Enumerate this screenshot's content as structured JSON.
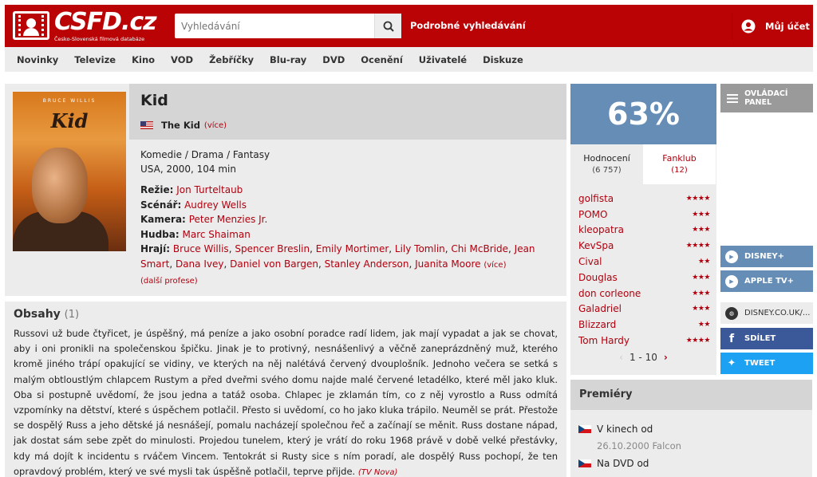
{
  "header": {
    "logo_text": "CSFD.cz",
    "logo_sub": "Česko-Slovenská filmová databáze",
    "search_placeholder": "Vyhledávání",
    "advanced_search": "Podrobné vyhledávání",
    "account": "Můj účet"
  },
  "nav": [
    "Novinky",
    "Televize",
    "Kino",
    "VOD",
    "Žebříčky",
    "Blu-ray",
    "DVD",
    "Ocenění",
    "Uživatelé",
    "Diskuze"
  ],
  "film": {
    "poster_top": "BRUCE WILLIS",
    "poster_title": "Kid",
    "title": "Kid",
    "orig_title": "The Kid",
    "more": "(více)",
    "genres": "Komedie / Drama / Fantasy",
    "origin": "USA, 2000, 104 min",
    "directing_label": "Režie:",
    "director": "Jon Turteltaub",
    "screenplay_label": "Scénář:",
    "screenwriter": "Audrey Wells",
    "camera_label": "Kamera:",
    "camera": "Peter Menzies Jr.",
    "music_label": "Hudba:",
    "music": "Marc Shaiman",
    "cast_label": "Hrají:",
    "cast": [
      "Bruce Willis",
      "Spencer Breslin",
      "Emily Mortimer",
      "Lily Tomlin",
      "Chi McBride",
      "Jean Smart",
      "Dana Ivey",
      "Daniel von Bargen",
      "Stanley Anderson",
      "Juanita Moore"
    ],
    "cast_more": "(více)",
    "more_professions": "(další profese)"
  },
  "plot": {
    "heading": "Obsahy",
    "count": "(1)",
    "text": "Russovi už bude čtyřicet, je úspěšný, má peníze a jako osobní poradce radí lidem, jak mají vypadat a jak se chovat, aby i oni pronikli na společenskou špičku. Jinak je to protivný, nesnášenlivý a věčně zaneprázdněný muž, kterého kromě jiného trápí opakující se vidiny, ve kterých na něj nalétává červený dvouplošník. Jednoho večera se setká s malým obtloustlým chlapcem Rustym a před dveřmi svého domu najde malé červené letadélko, které měl jako kluk. Oba si postupně uvědomí, že jsou jedna a tatáž osoba. Chlapec je zklamán tím, co z něj vyrostlo a Russ odmítá vzpomínky na dětství, které s úspěchem potlačil. Přesto si uvědomí, co ho jako kluka trápilo. Neuměl se prát. Přestože se dospělý Russ a jeho dětské já nesnášejí, pomalu nacházejí společnou řeč a začínají se měnit. Russ dostane nápad, jak dostat sám sebe zpět do minulosti. Projedou tunelem, který je vrátí do roku 1968 právě v době velké přestávky, kdy má dojít k incidentu s rváčem Vincem. Tentokrát si Rusty sice s ním poradí, ale dospělý Russ pochopí, že ten opravdový problém, který ve své mysli tak úspěšně potlačil, teprve přijde.",
    "source": "(TV Nova)"
  },
  "rating": {
    "score": "63%",
    "tab_ratings": "Hodnocení",
    "tab_ratings_count": "(6 757)",
    "tab_fanclub": "Fanklub",
    "tab_fanclub_count": "(12)",
    "users": [
      {
        "name": "golfista",
        "stars": "★★★★"
      },
      {
        "name": "POMO",
        "stars": "★★★"
      },
      {
        "name": "kleopatra",
        "stars": "★★★"
      },
      {
        "name": "KevSpa",
        "stars": "★★★★"
      },
      {
        "name": "Cival",
        "stars": "★★"
      },
      {
        "name": "Douglas",
        "stars": "★★★"
      },
      {
        "name": "don corleone",
        "stars": "★★★"
      },
      {
        "name": "Galadriel",
        "stars": "★★★"
      },
      {
        "name": "Blizzard",
        "stars": "★★"
      },
      {
        "name": "Tom Hardy",
        "stars": "★★★★"
      }
    ],
    "pager": "1 - 10"
  },
  "premieres": {
    "heading": "Premiéry",
    "cinema_label": "V kinech od",
    "cinema_date": "26.10.2000 Falcon",
    "dvd_label": "Na DVD od"
  },
  "sidebar": {
    "control_panel": "OVLÁDACÍ PANEL",
    "disney": "DISNEY+",
    "apple": "APPLE TV+",
    "website": "DISNEY.CO.UK/...",
    "share": "SDÍLET",
    "tweet": "TWEET"
  },
  "colors": {
    "brand": "#ba0305",
    "score_bg": "#658db5",
    "link": "#b1000e"
  }
}
